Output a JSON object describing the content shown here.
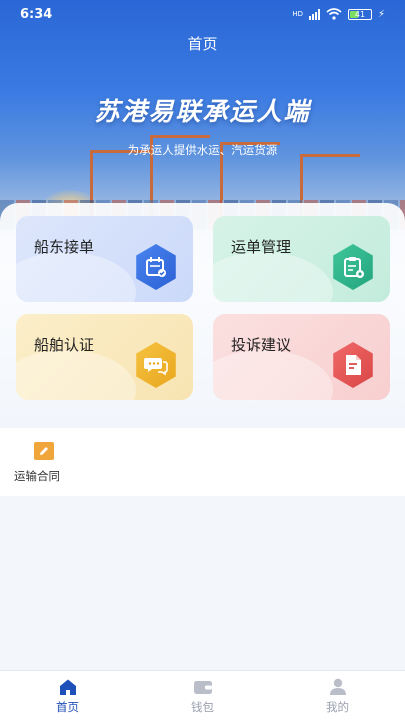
{
  "status_bar": {
    "time": "6:34",
    "network_tag": "HD",
    "battery_level": "41",
    "icons": [
      "signal-icon",
      "wifi-icon",
      "battery-icon",
      "charging-icon"
    ]
  },
  "header": {
    "nav_title": "首页",
    "main_title": "苏港易联承运人端",
    "subtitle": "为承运人提供水运、汽运货源"
  },
  "cards": [
    {
      "label": "船东接单",
      "icon": "order-calendar-icon",
      "color": "#2a5fd4"
    },
    {
      "label": "运单管理",
      "icon": "clipboard-icon",
      "color": "#22a47c"
    },
    {
      "label": "船舶认证",
      "icon": "chat-bubble-icon",
      "color": "#e9a51c"
    },
    {
      "label": "投诉建议",
      "icon": "document-icon",
      "color": "#d94545"
    }
  ],
  "extra": {
    "contract_label": "运输合同",
    "contract_icon": "pencil-icon"
  },
  "tabbar": {
    "items": [
      {
        "label": "首页",
        "icon": "home-icon",
        "active": true
      },
      {
        "label": "钱包",
        "icon": "wallet-icon",
        "active": false
      },
      {
        "label": "我的",
        "icon": "user-icon",
        "active": false
      }
    ],
    "active_color": "#1f4fb8"
  }
}
